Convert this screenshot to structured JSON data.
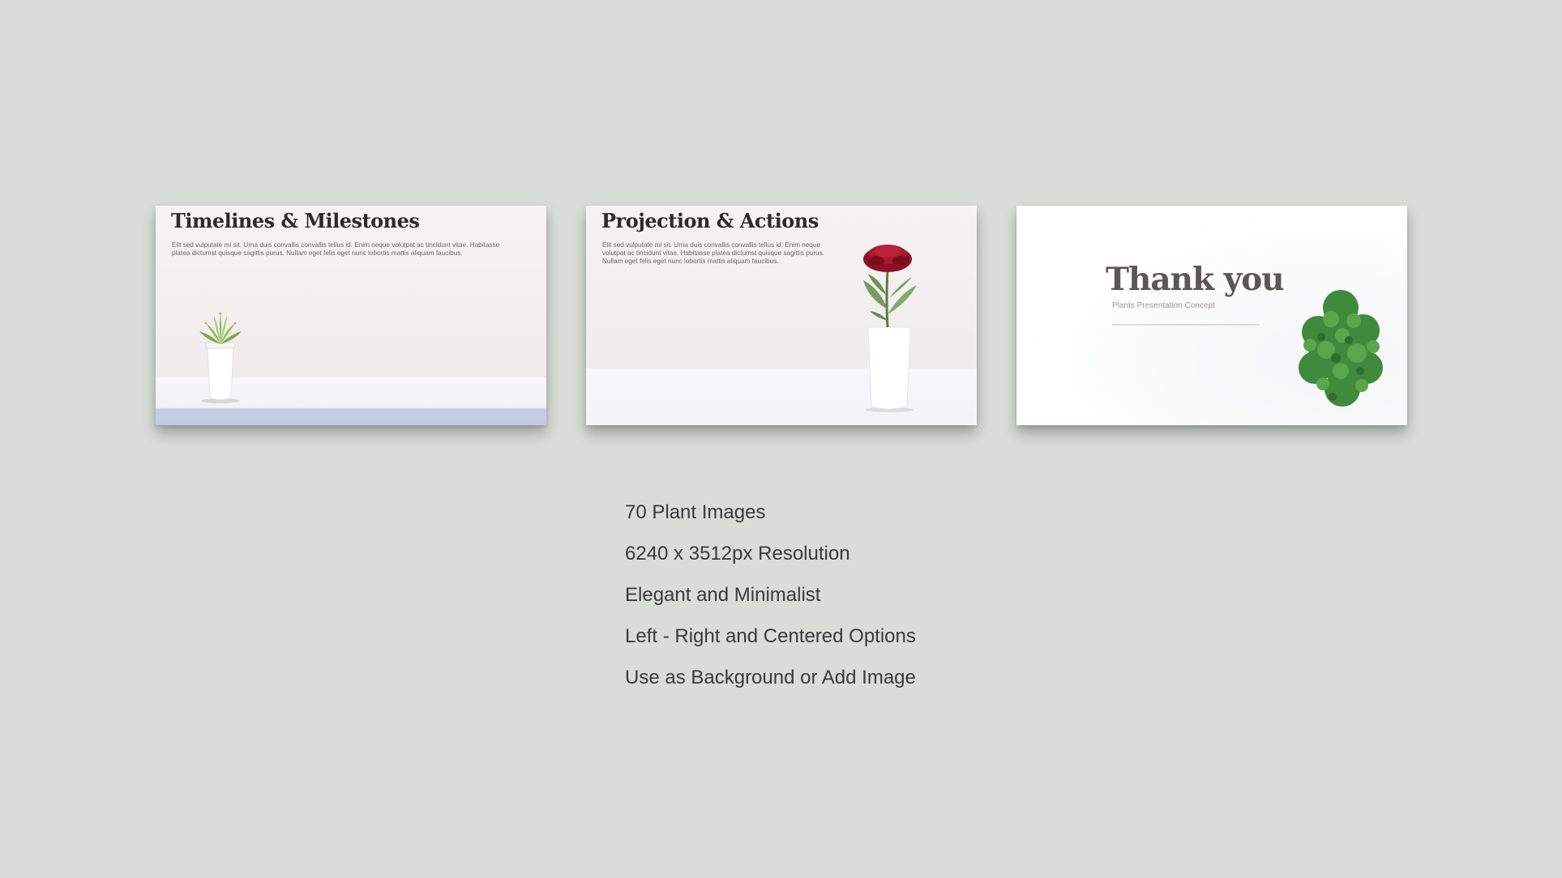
{
  "slides": [
    {
      "title": "Timelines & Milestones",
      "body": "Elit sed vulputate mi sit. Urna duis convallis convallis tellus id. Enim neque volutpat ac tincidunt vitae. Habitasse platea dictumst quisque sagittis purus. Nullam eget felis eget nunc lobortis mattis aliquam faucibus.",
      "image": "succulent-in-white-pot"
    },
    {
      "title": "Projection & Actions",
      "body": "Elit sed vulputate mi sit. Urna duis convallis convallis tellus id. Enim neque volutpat ac tincidunt vitae. Habitasse platea dictumst quisque sagittis purus. Nullam eget felis eget nunc lobortis mattis aliquam faucibus.",
      "image": "red-flower-in-white-pot"
    },
    {
      "title": "Thank you",
      "subtitle": "Plants Presentation Concept",
      "accent_line_color": "#d6e2cf",
      "image": "leafy-green-plant-top-view"
    }
  ],
  "features": [
    "70 Plant Images",
    "6240 x 3512px Resolution",
    "Elegant and Minimalist",
    "Left - Right and Centered Options",
    "Use as Background or Add Image"
  ],
  "colors": {
    "background": "#d8ddd8",
    "text": "#3a3a3a",
    "slide_title": "#2e2a28"
  }
}
